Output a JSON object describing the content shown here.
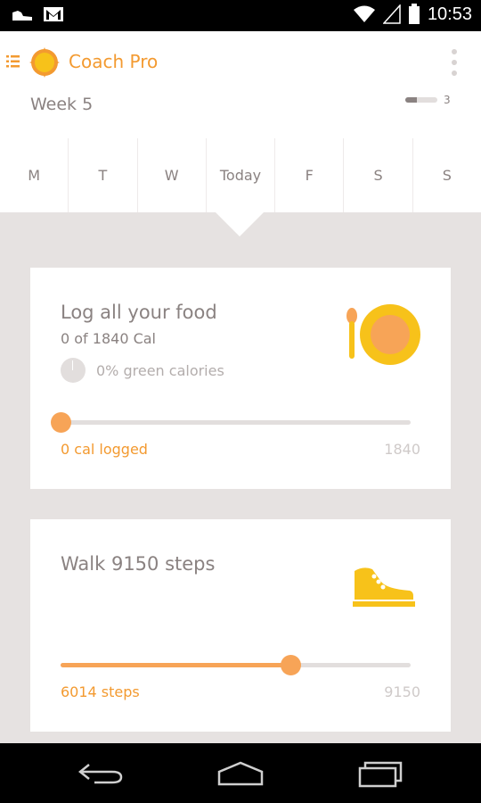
{
  "status_bar": {
    "time": "10:53",
    "icons": [
      "sneaker-notification-icon",
      "gmail-icon",
      "wifi-icon",
      "signal-icon",
      "battery-icon"
    ]
  },
  "header": {
    "app_title": "Coach Pro",
    "week_label": "Week 5",
    "week_progress_number": "3",
    "week_progress_fraction": 0.35
  },
  "days": [
    {
      "label": "M"
    },
    {
      "label": "T"
    },
    {
      "label": "W"
    },
    {
      "label": "Today"
    },
    {
      "label": "F"
    },
    {
      "label": "S"
    },
    {
      "label": "S"
    }
  ],
  "food_card": {
    "title": "Log all your food",
    "subtitle": "0 of 1840 Cal",
    "green_calories": "0% green calories",
    "logged_label": "0 cal logged",
    "goal_label": "1840",
    "progress_fraction": 0
  },
  "walk_card": {
    "title": "Walk 9150 steps",
    "steps_label": "6014 steps",
    "goal_label": "9150",
    "progress_fraction": 0.657
  },
  "colors": {
    "accent": "#f39a30",
    "slider": "#f7a457",
    "icon_yellow": "#f7c21a",
    "background": "#e6e2e1"
  }
}
